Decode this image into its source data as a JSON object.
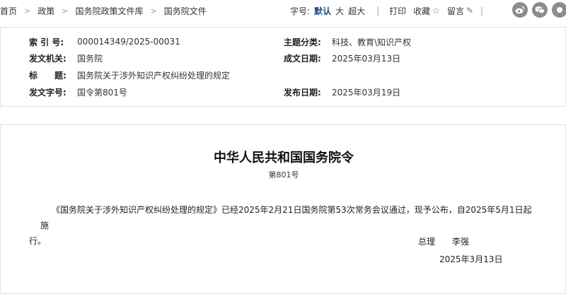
{
  "breadcrumb": {
    "items": [
      "首页",
      "政策",
      "国务院政策文件库",
      "国务院文件"
    ],
    "separator": ">"
  },
  "toolbar": {
    "font_size_label": "字号:",
    "font_sizes": [
      "默认",
      "大",
      "超大"
    ],
    "active_font_size": "默认",
    "divider": "|",
    "print_label": "打印",
    "favorite_label": "收藏",
    "comment_label": "留言"
  },
  "share": {
    "icons": [
      "weibo-icon",
      "wechat-icon",
      "more-icon"
    ],
    "color": "#8c8c8c"
  },
  "info": {
    "index_label": "索 引 号:",
    "index_value": "000014349/2025-00031",
    "category_label": "主题分类:",
    "category_value": "科技、教育\\知识产权",
    "issuer_label": "发文机关:",
    "issuer_value": "国务院",
    "written_date_label": "成文日期:",
    "written_date_value": "2025年03月13日",
    "title_label": "标　　题:",
    "title_value": "国务院关于涉外知识产权纠纷处理的规定",
    "doc_number_label": "发文字号:",
    "doc_number_value": "国令第801号",
    "publish_date_label": "发布日期:",
    "publish_date_value": "2025年03月19日"
  },
  "document": {
    "title": "中华人民共和国国务院令",
    "number": "第801号",
    "body_line1": "《国务院关于涉外知识产权纠纷处理的规定》已经2025年2月21日国务院第53次常务会议通过，现予公布，自2025年5月1日起施",
    "body_line2": "行。",
    "signer_title": "总理",
    "signer_name": "李强",
    "sign_date": "2025年3月13日"
  },
  "colors": {
    "accent": "#1a4f8b",
    "border": "#e1e1e1"
  }
}
